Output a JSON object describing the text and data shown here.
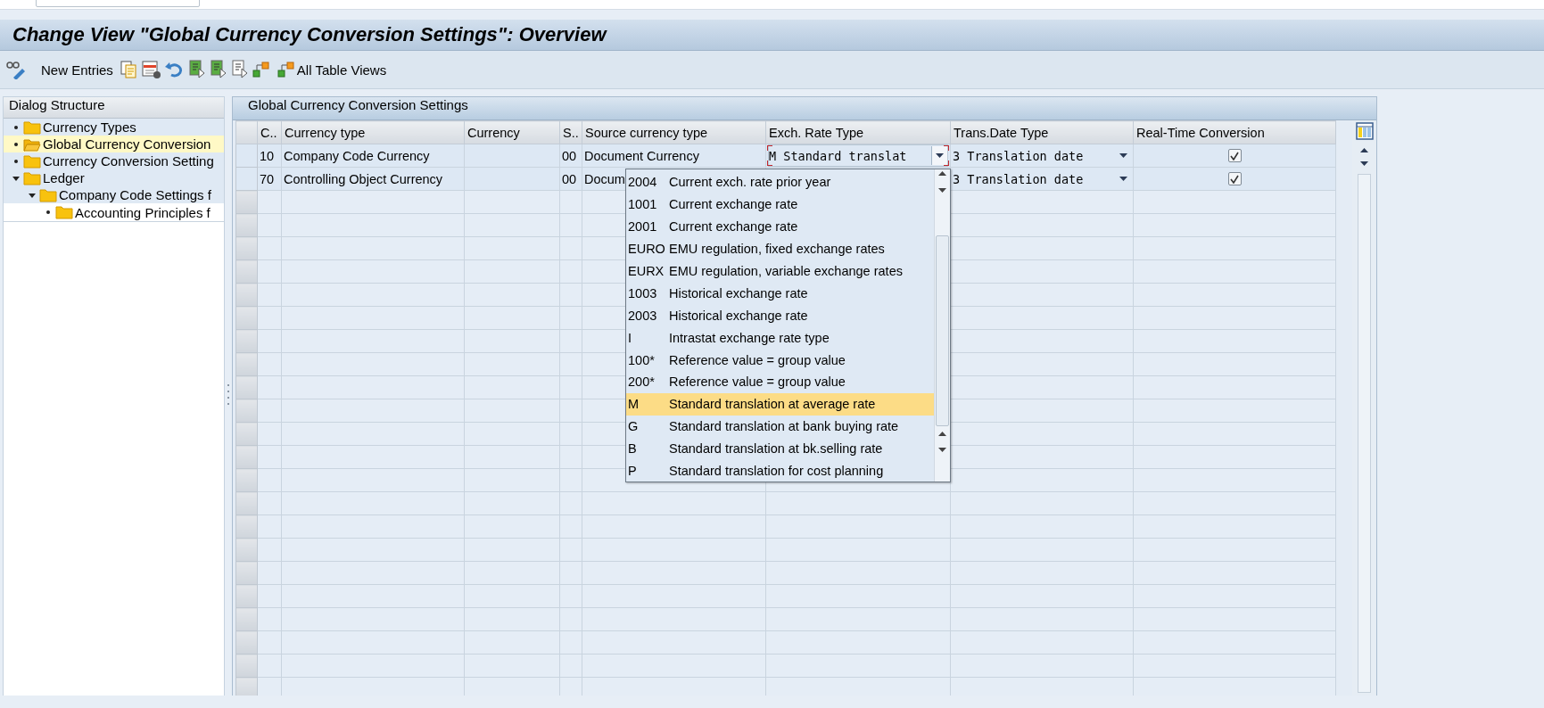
{
  "window": {
    "title": "Change View \"Global Currency Conversion Settings\": Overview"
  },
  "toolbar": {
    "buttons": [
      {
        "label": "New Entries"
      },
      {
        "label": "All Table Views"
      }
    ]
  },
  "dialog_structure": {
    "title": "Dialog Structure",
    "items": [
      {
        "label": "Currency Types",
        "selected": false
      },
      {
        "label": "Global Currency Conversion",
        "selected": true
      },
      {
        "label": "Currency Conversion Setting",
        "selected": false
      },
      {
        "label": "Ledger",
        "selected": false,
        "expanded": true,
        "children": [
          {
            "label": "Company Code Settings f",
            "selected": false,
            "expanded": true,
            "children": [
              {
                "label": "Accounting Principles f",
                "selected": false
              }
            ]
          }
        ]
      }
    ]
  },
  "table": {
    "title": "Global Currency Conversion Settings",
    "columns": [
      "C..",
      "Currency type",
      "Currency",
      "S..",
      "Source currency type",
      "Exch. Rate Type",
      "Trans.Date Type",
      "Real-Time Conversion"
    ],
    "rows": [
      [
        {
          "kind": "text",
          "text": "10"
        },
        {
          "kind": "text",
          "text": "Company Code Currency"
        },
        {
          "kind": "text"
        },
        {
          "kind": "text",
          "text": "00"
        },
        {
          "kind": "text",
          "text": "Document Currency"
        },
        {
          "kind": "dropdown",
          "text": "M Standard translat",
          "focused": true
        },
        {
          "kind": "dropdown",
          "text": "3 Translation date",
          "focused": false
        },
        {
          "kind": "checkbox",
          "checked": true
        }
      ],
      [
        {
          "kind": "text",
          "text": "70"
        },
        {
          "kind": "text",
          "text": "Controlling Object Currency"
        },
        {
          "kind": "text"
        },
        {
          "kind": "text",
          "text": "00"
        },
        {
          "kind": "text",
          "text": "Docum"
        },
        {
          "kind": "covered"
        },
        {
          "kind": "dropdown",
          "text": "3 Translation date",
          "focused": false
        },
        {
          "kind": "checkbox",
          "checked": true
        }
      ]
    ]
  },
  "dropdown_list": {
    "options": [
      {
        "code": "2004",
        "text": "Current exch. rate prior year",
        "selected": false
      },
      {
        "code": "1001",
        "text": "Current exchange rate",
        "selected": false
      },
      {
        "code": "2001",
        "text": "Current exchange rate",
        "selected": false
      },
      {
        "code": "EURO",
        "text": "EMU regulation, fixed exchange rates",
        "selected": false
      },
      {
        "code": "EURX",
        "text": "EMU regulation, variable exchange rates",
        "selected": false
      },
      {
        "code": "1003",
        "text": "Historical exchange rate",
        "selected": false
      },
      {
        "code": "2003",
        "text": "Historical exchange rate",
        "selected": false
      },
      {
        "code": "I",
        "text": "Intrastat exchange rate type",
        "selected": false
      },
      {
        "code": "100*",
        "text": "Reference value = group value",
        "selected": false
      },
      {
        "code": "200*",
        "text": "Reference value = group value",
        "selected": false
      },
      {
        "code": "M",
        "text": "Standard translation at average rate",
        "selected": true
      },
      {
        "code": "G",
        "text": "Standard translation at bank buying rate",
        "selected": false
      },
      {
        "code": "B",
        "text": "Standard translation at bk.selling rate",
        "selected": false
      },
      {
        "code": "P",
        "text": "Standard translation for cost planning",
        "selected": false
      }
    ]
  }
}
